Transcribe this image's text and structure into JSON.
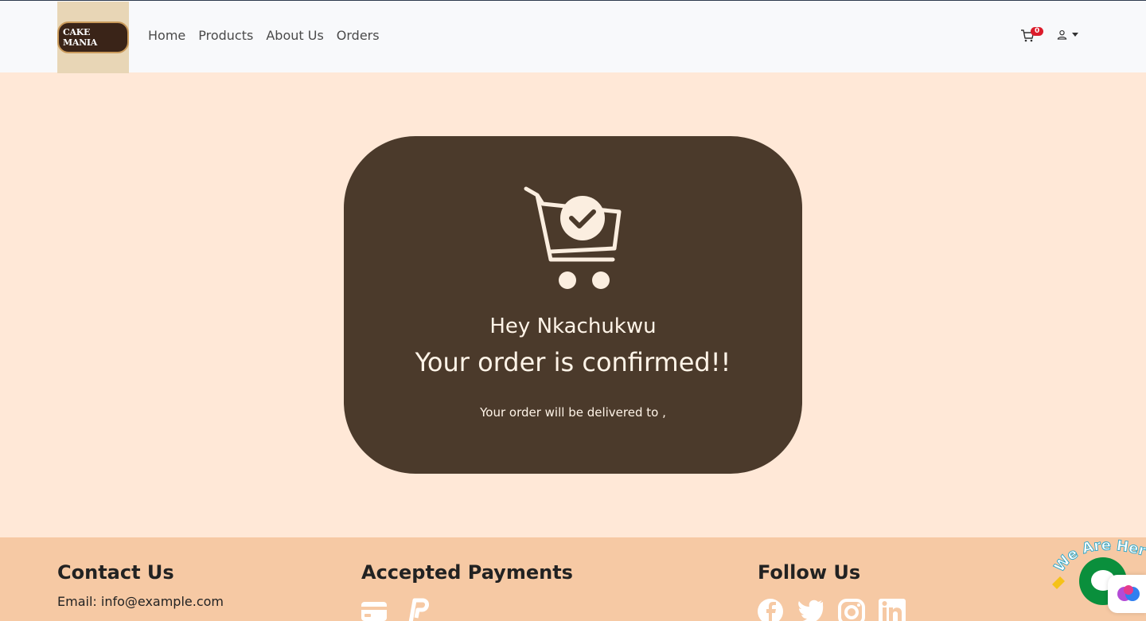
{
  "brand": {
    "logo_text": "CAKE MANIA"
  },
  "nav": {
    "items": [
      "Home",
      "Products",
      "About Us",
      "Orders"
    ]
  },
  "header": {
    "cart_count": "0"
  },
  "order": {
    "greeting": "Hey Nkachukwu",
    "headline": "Your order is confirmed!!",
    "delivery": "Your order will be delivered to ,"
  },
  "footer": {
    "contact_title": "Contact Us",
    "email": "Email: info@example.com",
    "payments_title": "Accepted Payments",
    "payment_icons": [
      "credit-card-icon",
      "paypal-icon"
    ],
    "follow_title": "Follow Us",
    "social_icons": [
      "facebook-icon",
      "twitter-icon",
      "instagram-icon",
      "linkedin-icon"
    ]
  },
  "chat": {
    "banner": "We Are Here!"
  },
  "colors": {
    "page_bg": "#ffe8d7",
    "card_bg": "#4b3a2b",
    "footer_bg": "#f6c9a4",
    "badge": "#dc1c2b",
    "chat_green": "#0a8f3c"
  }
}
